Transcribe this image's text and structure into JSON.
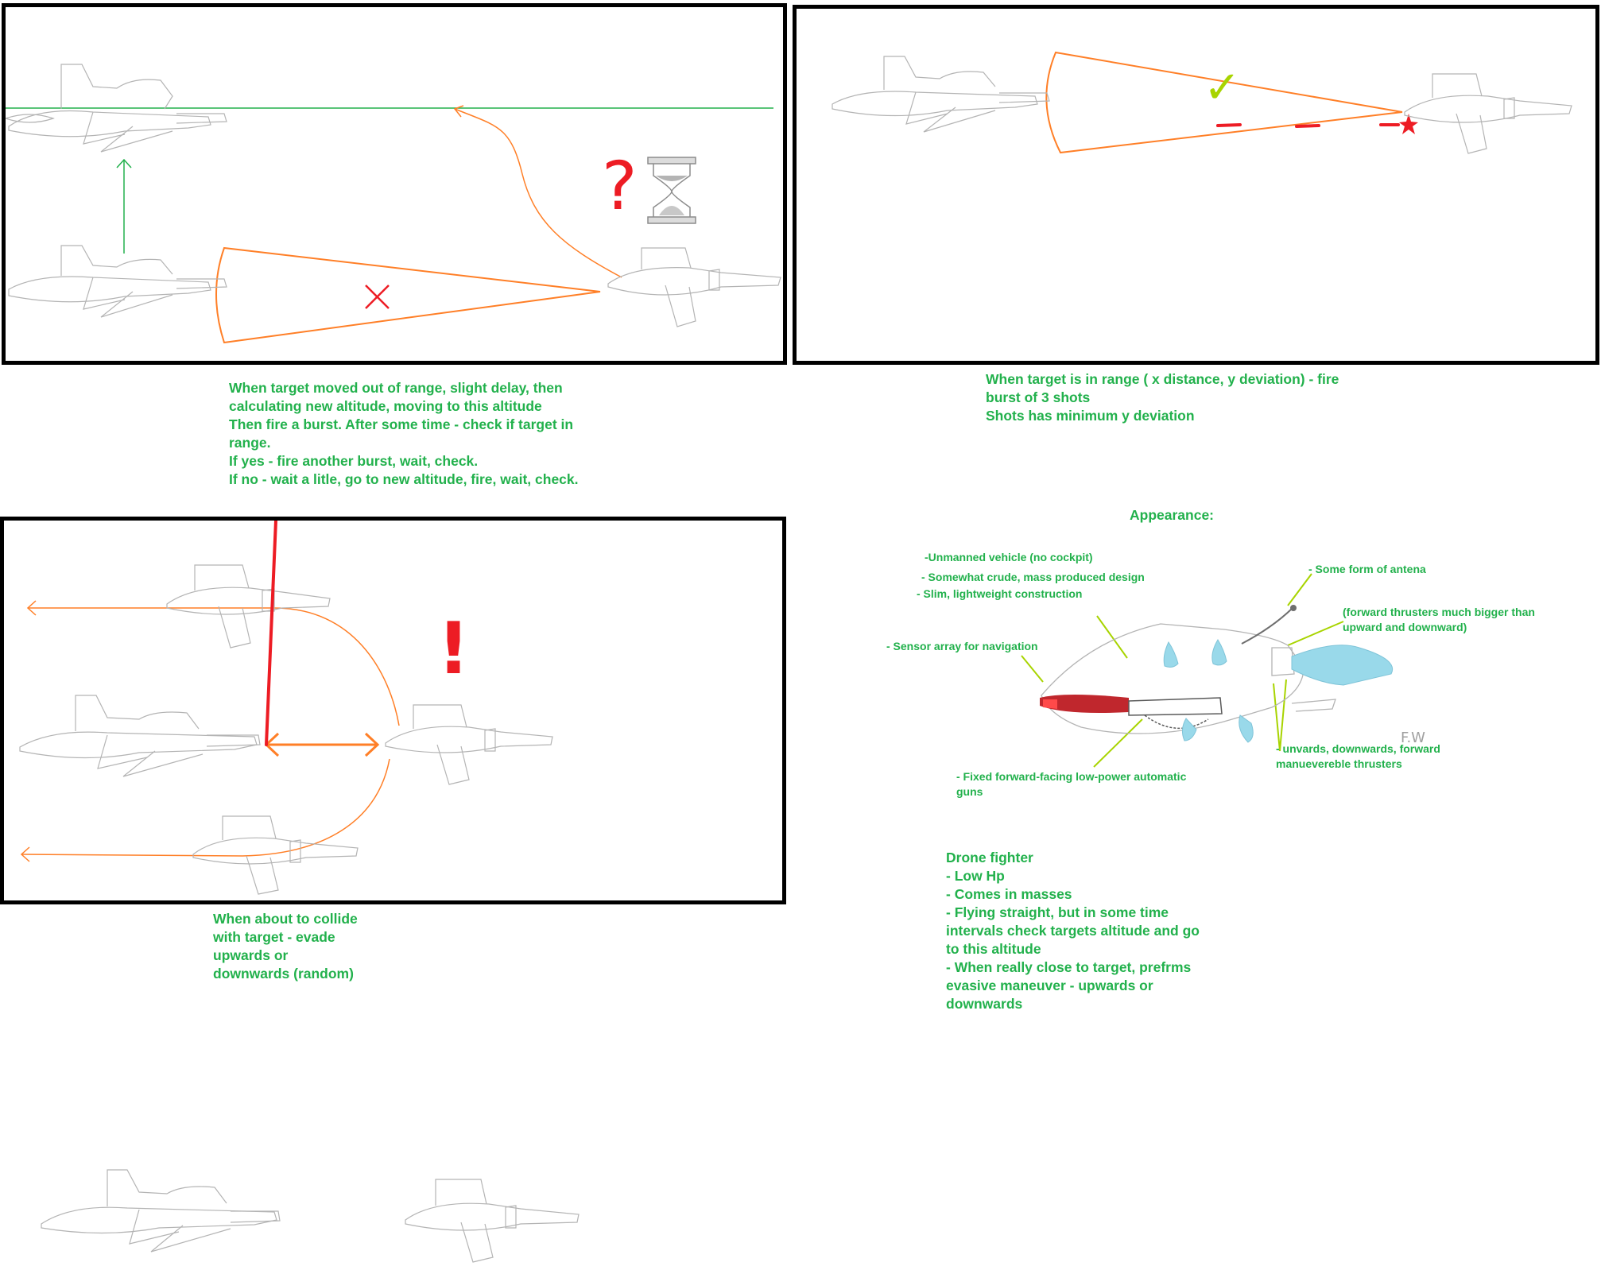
{
  "panels": {
    "out_of_range": {
      "caption": [
        "When target moved out of range, slight delay, then",
        "calculating new altitude, moving to this altitude",
        "Then  fire a burst. After some time - check if target in",
        "range.",
        "If yes - fire another burst, wait, check.",
        "If no - wait a litle, go to new altitude, fire, wait, check."
      ],
      "question_mark": "?"
    },
    "in_range": {
      "caption": [
        "When target is in range ( x distance, y deviation) - fire",
        "burst of 3 shots",
        "Shots has minimum y deviation"
      ],
      "check_mark": "✓"
    },
    "collide": {
      "caption": [
        "When about to collide",
        "with target - evade",
        "upwards or",
        "downwards (random)"
      ],
      "exclamation": "!"
    }
  },
  "appearance": {
    "heading": "Appearance:",
    "annotations": {
      "unmanned": "-Unmanned vehicle (no cockpit)",
      "crude": "- Somewhat crude, mass produced design",
      "slim": "- Slim, lightweight construction",
      "antenna": "- Some form of antena",
      "forward_thrusters": [
        "(forward thrusters much bigger than",
        "upward and downward)"
      ],
      "sensor": "- Sensor array for navigation",
      "thrusters": [
        "- unvards, downwards, forward",
        "manuevereble thrusters"
      ],
      "guns": [
        "- Fixed forward-facing low-power automatic",
        "guns"
      ]
    },
    "signature": "F.W",
    "description": [
      "Drone fighter",
      "- Low Hp",
      "- Comes in masses",
      "- Flying straight, but in some time",
      "intervals check targets altitude and go",
      "to this altitude",
      "- When really close to target, prefrms",
      "evasive maneuver - upwards or",
      "downwards"
    ]
  },
  "colors": {
    "text_green": "#22b14c",
    "line_green": "#22b14c",
    "orange": "#ff7f27",
    "red": "#ed1c24",
    "lime": "#a8d400",
    "sketch_grey": "#b4b4b4",
    "thruster_blue": "#99d9ea"
  }
}
